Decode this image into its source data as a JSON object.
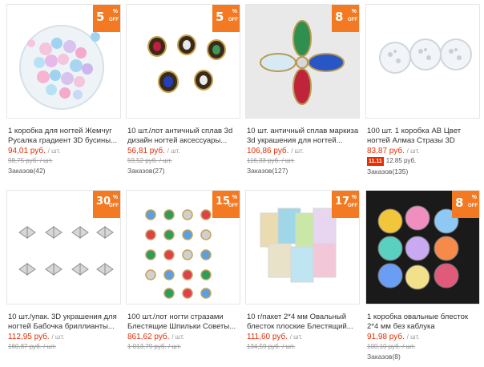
{
  "products": [
    {
      "badge": "5",
      "title": "1 коробка для ногтей Жемчуг Русалка градиент 3D бусины...",
      "price": "94,01 руб.",
      "unit": "/ шт.",
      "old_price": "98,75 руб.",
      "old_unit": "/ шт.",
      "orders": "Заказов(42)"
    },
    {
      "badge": "5",
      "title": "10 шт./лот античный сплав 3d дизайн ногтей аксессуары...",
      "price": "56,81 руб.",
      "unit": "/ шт.",
      "old_price": "59,52 руб.",
      "old_unit": "/ шт.",
      "orders": "Заказов(27)"
    },
    {
      "badge": "8",
      "title": "10 шт. античный сплав маркиза 3d украшения для ногтей...",
      "price": "106,86 руб.",
      "unit": "/ шт.",
      "old_price": "116,33 руб.",
      "old_unit": "/ шт.",
      "orders": "Заказов(127)"
    },
    {
      "badge": "",
      "title": "100 шт. 1 коробка AB Цвет ногтей Алмаз Стразы 3D дизайн...",
      "price": "83,87 руб.",
      "unit": "/ шт.",
      "promo_tag": "11.11",
      "promo_text": "12.85 руб.",
      "orders": "Заказов(135)"
    },
    {
      "badge": "30",
      "title": "10 шт./упак. 3D украшения для ногтей Бабочка бриллианты...",
      "price": "112,95 руб.",
      "unit": "/ шт.",
      "old_price": "160,87 руб.",
      "old_unit": "/ шт.",
      "orders": ""
    },
    {
      "badge": "15",
      "title": "100 шт./лот ногти стразами Блестящие Шпильки Советы...",
      "price": "861,62 руб.",
      "unit": "/ шт.",
      "old_price": "1 013,79 руб.",
      "old_unit": "/ шт.",
      "orders": ""
    },
    {
      "badge": "17",
      "title": "10 г/пакет 2*4 мм Овальный блесток плоские Блестящий...",
      "price": "111,60 руб.",
      "unit": "/ шт.",
      "old_price": "134,59 руб.",
      "old_unit": "/ шт.",
      "orders": ""
    },
    {
      "badge": "8",
      "title": "1 коробка овальные блесток 2*4 мм без каблука Блестящий...",
      "price": "91,98 руб.",
      "unit": "/ шт.",
      "old_price": "100,10 руб.",
      "old_unit": "/ шт.",
      "orders": "Заказов(8)"
    }
  ],
  "badge_off_text": "OFF",
  "badge_pct_text": "%",
  "colors": {
    "accent": "#f37a22",
    "price": "#e62e04"
  }
}
